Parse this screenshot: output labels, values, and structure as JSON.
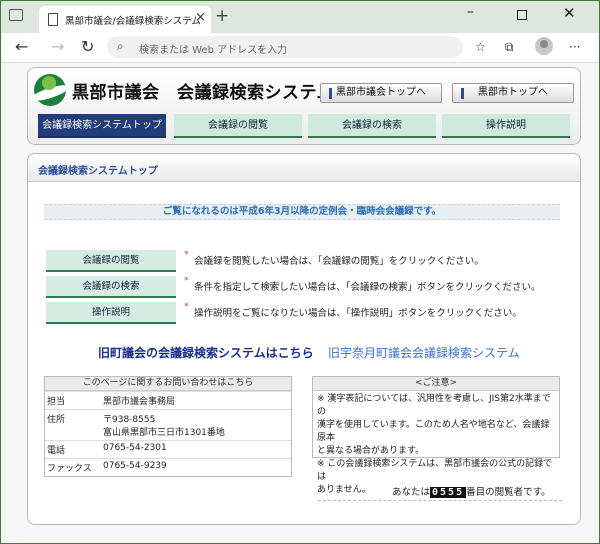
{
  "browser": {
    "tab_title": "黒部市議会/会議録検索システム",
    "address_placeholder": "検索または Web アドレスを入力"
  },
  "header": {
    "site_title": "黒部市議会　会議録検索システム",
    "top_links": [
      "黒部市議会トップへ",
      "黒部市トップへ"
    ],
    "menu": [
      "会議録検索システムトップ",
      "会議録の閲覧",
      "会議録の検索",
      "操作説明"
    ]
  },
  "content": {
    "heading": "会議録検索システムトップ",
    "notice": "ご覧になれるのは平成6年3月以降の定例会・臨時会会議録です。",
    "actions": [
      {
        "label": "会議録の閲覧",
        "desc": "会議録を閲覧したい場合は、「会議録の閲覧」をクリックください。"
      },
      {
        "label": "会議録の検索",
        "desc": "条件を指定して検索したい場合は、「会議録の検索」ボタンをクリックください。"
      },
      {
        "label": "操作説明",
        "desc": "操作説明をご覧になりたい場合は、「操作説明」ボタンをクリックください。"
      }
    ],
    "old_link_1": "旧町議会の会議録検索システムはこちら",
    "old_link_2": "旧宇奈月町議会会議録検索システム",
    "contact": {
      "title": "このページに関するお問い合わせはこちら",
      "rows": [
        {
          "label": "担当",
          "value": "黒部市議会事務局"
        },
        {
          "label": "住所",
          "value": "〒938-8555"
        },
        {
          "label": "",
          "value": "富山県黒部市三日市1301番地"
        },
        {
          "label": "電話",
          "value": "0765-54-2301"
        },
        {
          "label": "ファックス",
          "value": "0765-54-9239"
        }
      ]
    },
    "notes": {
      "title": "<ご注意>",
      "lines": [
        "※ 漢字表記については、汎用性を考慮し、JIS第2水準までの",
        "漢字を使用しています。このため人名や地名など、会議録原本",
        "と異なる場合があります。",
        "※ この会議録検索システムは、黒部市議会の公式の記録では",
        "ありません。"
      ]
    },
    "counter": {
      "prefix": "あなたは",
      "digits": "0555",
      "suffix": "番目の閲覧者です。"
    }
  },
  "colors": {
    "accent": "#233c7a",
    "menu_bg": "#cfeadd",
    "link": "#1a2f8a"
  }
}
